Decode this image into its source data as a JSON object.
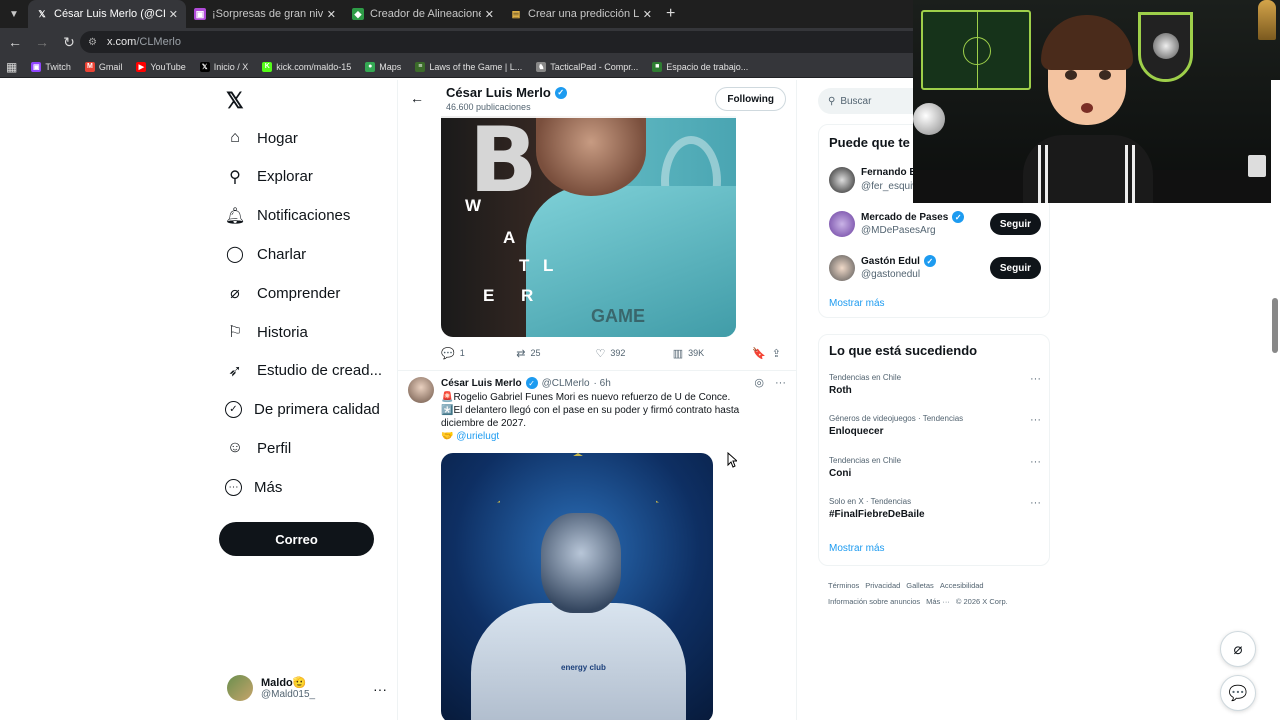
{
  "browser": {
    "tabs": [
      {
        "title": "César Luis Merlo (@CLMerlo) /",
        "active": true,
        "icon": "x-favicon"
      },
      {
        "title": "¡Sorpresas de gran nivel! Los fic",
        "active": false,
        "icon": "twitch-favicon"
      },
      {
        "title": "Creador de Alineaciones de Fútb",
        "active": false,
        "icon": "lineup-favicon"
      },
      {
        "title": "Crear una predicción Liga de Pr",
        "active": false,
        "icon": "doc-favicon"
      }
    ],
    "url_host": "x.com",
    "url_path": "/CLMerlo",
    "bookmarks": [
      {
        "label": "Twitch",
        "color": "#9146ff"
      },
      {
        "label": "Gmail",
        "color": "#ea4335"
      },
      {
        "label": "YouTube",
        "color": "#ff0000"
      },
      {
        "label": "Inicio / X",
        "color": "#000000"
      },
      {
        "label": "kick.com/maldo-15",
        "color": "#53fc18"
      },
      {
        "label": "Maps",
        "color": "#34a853"
      },
      {
        "label": "Laws of the Game | L...",
        "color": "#3b6b2a"
      },
      {
        "label": "TacticalPad - Compr...",
        "color": "#888888"
      },
      {
        "label": "Espacio de trabajo...",
        "color": "#2e7d32"
      }
    ]
  },
  "nav": {
    "items": [
      {
        "label": "Hogar",
        "icon": "home-icon"
      },
      {
        "label": "Explorar",
        "icon": "search-icon"
      },
      {
        "label": "Notificaciones",
        "icon": "bell-icon"
      },
      {
        "label": "Charlar",
        "icon": "chat-icon"
      },
      {
        "label": "Comprender",
        "icon": "grok-icon"
      },
      {
        "label": "Historia",
        "icon": "bookmark-icon"
      },
      {
        "label": "Estudio de cread...",
        "icon": "rocket-icon"
      },
      {
        "label": "De primera calidad",
        "icon": "verified-icon"
      },
      {
        "label": "Perfil",
        "icon": "person-icon"
      },
      {
        "label": "Más",
        "icon": "more-circle-icon"
      }
    ],
    "post_button": "Correo",
    "account": {
      "name": "Maldo🫡",
      "handle": "@Mald015_"
    }
  },
  "profile_header": {
    "name": "César Luis Merlo",
    "posts": "46.600 publicaciones",
    "follow_label": "Following"
  },
  "tweet1": {
    "image_letters": [
      "W",
      "A",
      "L",
      "T",
      "E",
      "R"
    ],
    "image_word": "GAME",
    "replies": "1",
    "reposts": "25",
    "likes": "392",
    "views": "39K"
  },
  "tweet2": {
    "name": "César Luis Merlo",
    "handle": "@CLMerlo",
    "time": "· 6h",
    "line1": "🚨Rogelio Gabriel Funes Mori es nuevo refuerzo de U de Conce.",
    "line2": "*️⃣El delantero llegó con el pase en su poder y firmó contrato hasta diciembre de 2027.",
    "line3_prefix": "🤝",
    "mention": "@urielugt",
    "sponsor": "energy club"
  },
  "right_rail": {
    "search_placeholder": "Buscar",
    "who_to_follow_title": "Puede que te",
    "who": [
      {
        "name": "Fernando B",
        "handle": "@fer_esquive",
        "verified": false,
        "button": ""
      },
      {
        "name": "Mercado de Pases",
        "handle": "@MDePasesArg",
        "verified": true,
        "button": "Seguir"
      },
      {
        "name": "Gastón Edul",
        "handle": "@gastonedul",
        "verified": true,
        "button": "Seguir"
      }
    ],
    "show_more": "Mostrar más",
    "trends_title": "Lo que está sucediendo",
    "trends": [
      {
        "context": "Tendencias en Chile",
        "name": "Roth"
      },
      {
        "context": "Géneros de videojuegos · Tendencias",
        "name": "Enloquecer"
      },
      {
        "context": "Tendencias en Chile",
        "name": "Coni"
      },
      {
        "context": "Solo en X · Tendencias",
        "name": "#FinalFiebreDeBaile"
      }
    ],
    "trends_show_more": "Mostrar más",
    "footer": [
      "Términos",
      "Privacidad",
      "Galletas",
      "Accesibilidad",
      "Información sobre anuncios",
      "Más ···",
      "© 2026 X Corp."
    ]
  },
  "colors": {
    "accent": "#1d9bf0",
    "text": "#0f1419",
    "muted": "#536471"
  }
}
